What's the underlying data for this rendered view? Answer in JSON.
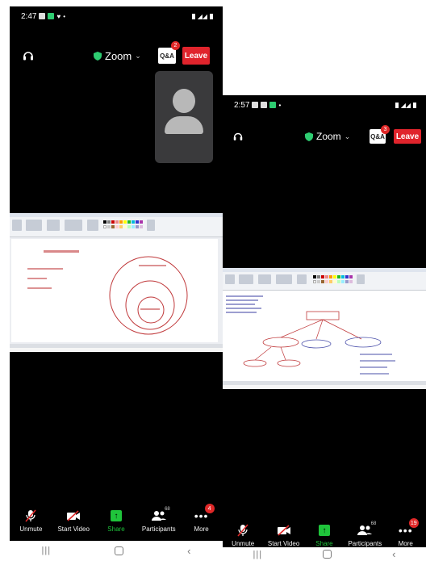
{
  "phones": [
    {
      "status": {
        "time": "2:47",
        "signal": " ▮⦁◢◢▮"
      },
      "meeting": {
        "title": "Zoom",
        "qa_label": "Q&A",
        "qa_badge": "2",
        "leave_label": "Leave"
      },
      "controls": {
        "unmute": "Unmute",
        "start_video": "Start Video",
        "share": "Share",
        "participants": "Participants",
        "participants_count": "68",
        "more": "More",
        "more_badge": "4"
      }
    },
    {
      "status": {
        "time": "2:57",
        "signal": "▮⦁◢◢▮"
      },
      "meeting": {
        "title": "Zoom",
        "qa_label": "Q&A",
        "qa_badge": "3",
        "leave_label": "Leave"
      },
      "controls": {
        "unmute": "Unmute",
        "start_video": "Start Video",
        "share": "Share",
        "participants": "Participants",
        "participants_count": "68",
        "more": "More",
        "more_badge": "19"
      }
    }
  ],
  "colors": {
    "leave": "#e0242c",
    "share_green": "#1fc43b",
    "badge_red": "#e02828",
    "drawing_red": "#c0393b",
    "drawing_blue": "#4a4faa"
  }
}
